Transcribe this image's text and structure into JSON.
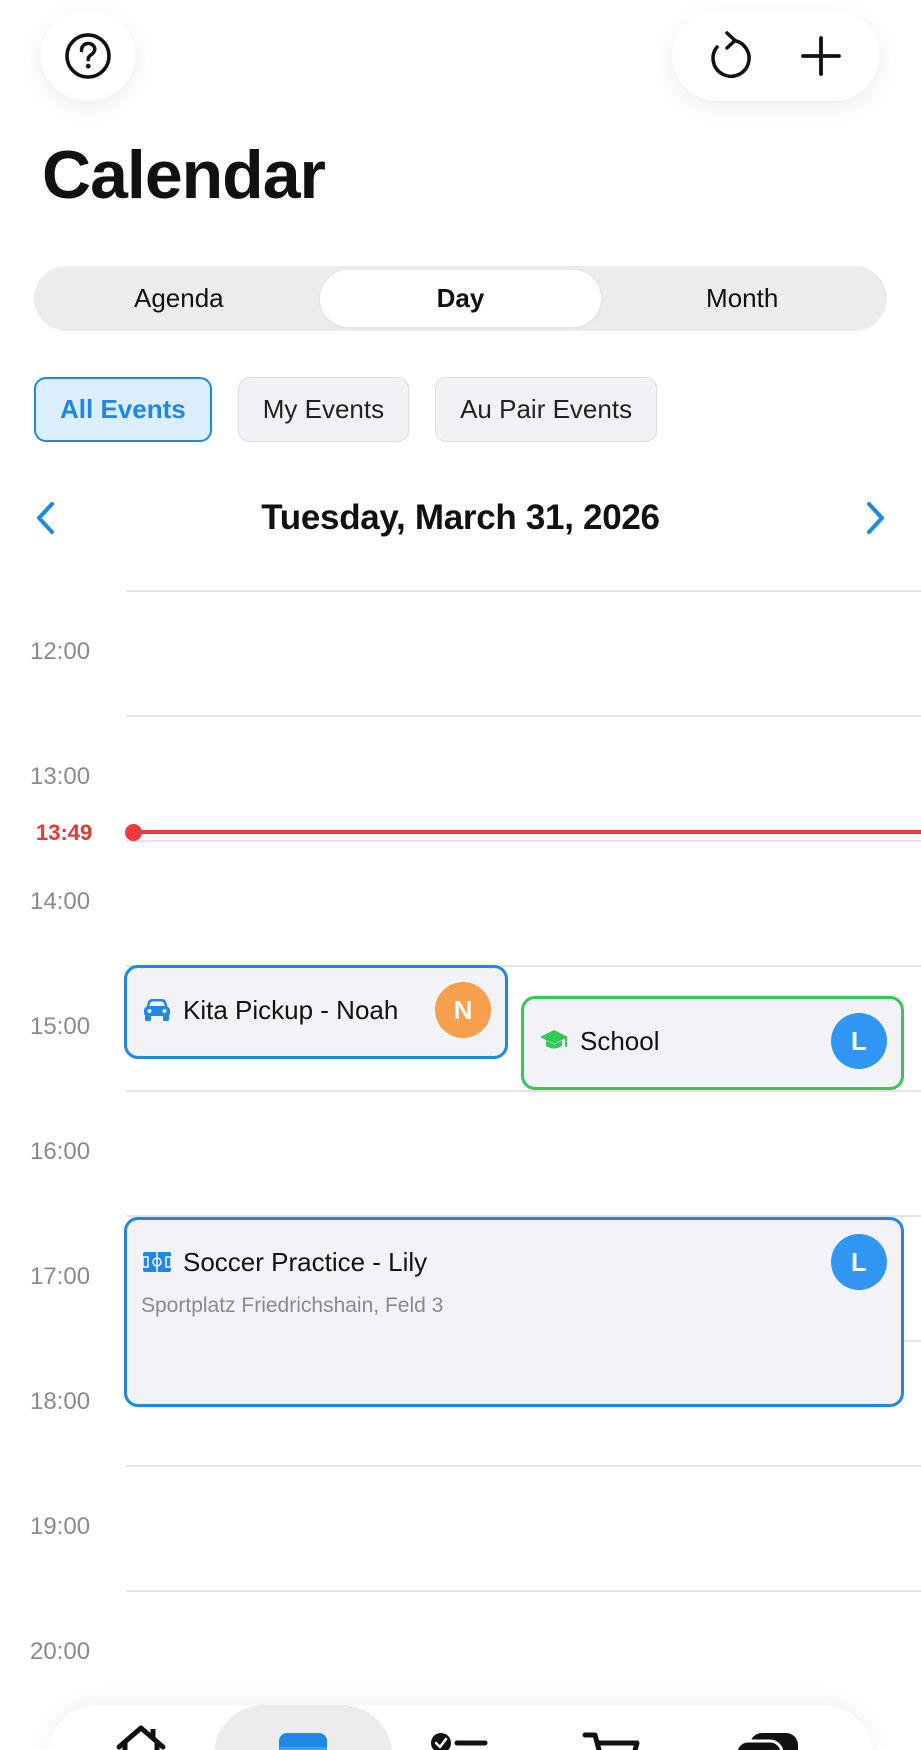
{
  "header": {
    "help_icon": "question-circle-icon",
    "refresh_icon": "refresh-icon",
    "add_icon": "plus-icon",
    "title": "Calendar"
  },
  "view_switcher": {
    "options": [
      "Agenda",
      "Day",
      "Month"
    ],
    "selected": "Day"
  },
  "filters": {
    "chips": [
      "All Events",
      "My Events",
      "Au Pair Events"
    ],
    "selected": "All Events"
  },
  "date_nav": {
    "prev_icon": "chevron-left-icon",
    "next_icon": "chevron-right-icon",
    "date": "Tuesday, March 31, 2026"
  },
  "timeline": {
    "hours": [
      "12:00",
      "13:00",
      "14:00",
      "15:00",
      "16:00",
      "17:00",
      "18:00",
      "19:00",
      "20:00"
    ],
    "now": "13:49"
  },
  "events": [
    {
      "title": "Kita Pickup - Noah",
      "icon": "car-icon",
      "avatar": "N",
      "avatar_color": "#f6a04d",
      "border_color": "#1e88e5",
      "location": ""
    },
    {
      "title": "School",
      "icon": "graduation-cap-icon",
      "avatar": "L",
      "avatar_color": "#2f96f3",
      "border_color": "#34c759",
      "location": ""
    },
    {
      "title": "Soccer Practice - Lily",
      "icon": "soccer-field-icon",
      "avatar": "L",
      "avatar_color": "#2f96f3",
      "border_color": "#1e88e5",
      "location": "Sportplatz Friedrichshain, Feld 3"
    }
  ],
  "tab_bar": {
    "icons": [
      "home-icon",
      "calendar-icon",
      "checklist-icon",
      "cart-icon",
      "chat-icon"
    ],
    "selected": "calendar-icon"
  },
  "colors": {
    "accent": "#1e88e5",
    "now_indicator": "#f0393e",
    "school_green": "#34c759"
  }
}
